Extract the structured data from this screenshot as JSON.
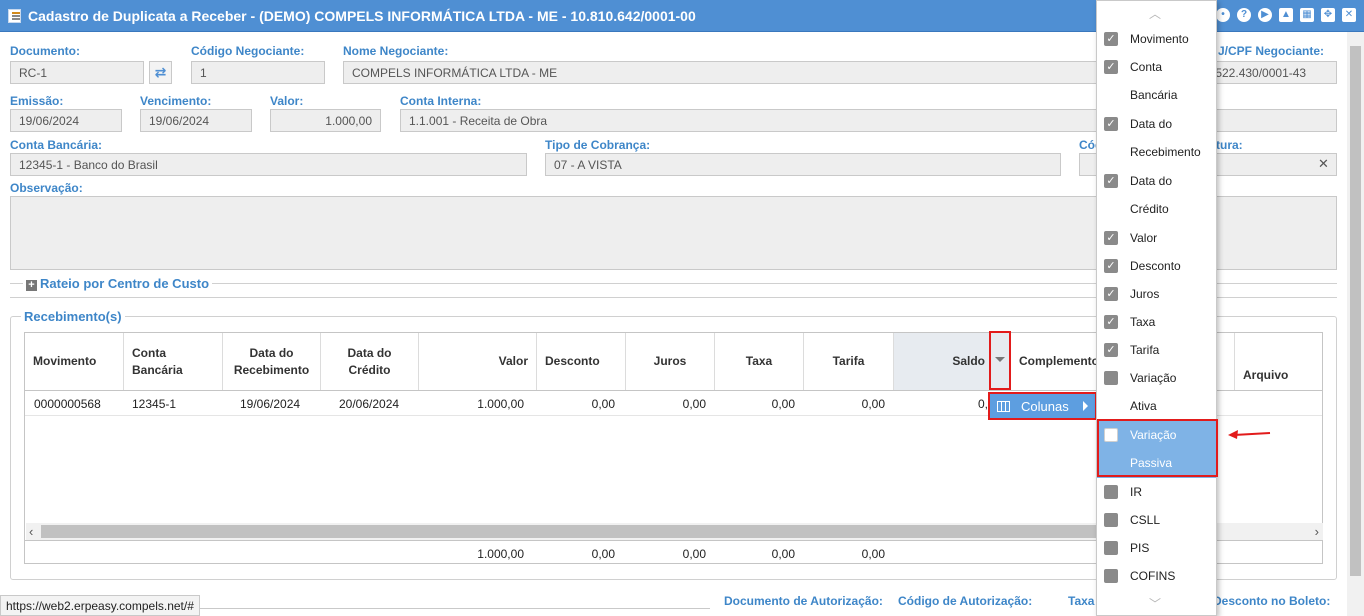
{
  "window": {
    "title": "Cadastro de Duplicata a Receber - (DEMO) COMPELS INFORMÁTICA LTDA - ME - 10.810.642/0001-00",
    "icons": [
      "settings-icon",
      "help-icon",
      "play-icon",
      "bell-icon",
      "calendar-icon",
      "expand-icon",
      "close-icon"
    ]
  },
  "form": {
    "documento_label": "Documento:",
    "documento_value": "RC-1",
    "codigo_negociante_label": "Código Negociante:",
    "codigo_negociante_value": "1",
    "nome_negociante_label": "Nome Negociante:",
    "nome_negociante_value": "COMPELS INFORMÁTICA LTDA - ME",
    "cnpj_label": "J/CPF Negociante:",
    "cnpj_value": ".522.430/0001-43",
    "emissao_label": "Emissão:",
    "emissao_value": "19/06/2024",
    "vencimento_label": "Vencimento:",
    "vencimento_value": "19/06/2024",
    "valor_label": "Valor:",
    "valor_value": "1.000,00",
    "conta_interna_label": "Conta Interna:",
    "conta_interna_value": "1.1.001 - Receita de Obra",
    "conta_bancaria_label": "Conta Bancária:",
    "conta_bancaria_value": "12345-1 - Banco do Brasil",
    "tipo_cobranca_label": "Tipo de Cobrança:",
    "tipo_cobranca_value": "07 - A VISTA",
    "codigo_truncated_label": "Cód",
    "fatura_truncated_label": "tura:",
    "observacao_label": "Observação:",
    "rateio_label": "Rateio por Centro de Custo",
    "recebimentos_label": "Recebimento(s)",
    "documento_autorizacao_label": "Documento de Autorização:",
    "codigo_autorizacao_label": "Código de Autorização:",
    "taxa_truncated_label": "Taxa",
    "desconto_boleto_label": "Desconto no Boleto:"
  },
  "grid": {
    "headers": {
      "movimento": "Movimento",
      "conta_bancaria_1": "Conta",
      "conta_bancaria_2": "Bancária",
      "data_recebimento_1": "Data do",
      "data_recebimento_2": "Recebimento",
      "data_credito_1": "Data do",
      "data_credito_2": "Crédito",
      "valor": "Valor",
      "desconto": "Desconto",
      "juros": "Juros",
      "taxa": "Taxa",
      "tarifa": "Tarifa",
      "saldo": "Saldo",
      "complemento": "Complemento",
      "arquivo": "Arquivo"
    },
    "row": {
      "movimento": "0000000568",
      "conta": "12345-1",
      "data_recebimento": "19/06/2024",
      "data_credito": "20/06/2024",
      "valor": "1.000,00",
      "desconto": "0,00",
      "juros": "0,00",
      "taxa": "0,00",
      "tarifa": "0,00",
      "saldo": "0,"
    },
    "totals": {
      "valor": "1.000,00",
      "desconto": "0,00",
      "juros": "0,00",
      "taxa": "0,00",
      "tarifa": "0,00"
    }
  },
  "column_menu": {
    "colunas_label": "Colunas",
    "items": [
      {
        "label_1": "Movimento",
        "label_2": "",
        "checked": true
      },
      {
        "label_1": "Conta",
        "label_2": "Bancária",
        "checked": true
      },
      {
        "label_1": "Data do",
        "label_2": "Recebimento",
        "checked": true
      },
      {
        "label_1": "Data do",
        "label_2": "Crédito",
        "checked": true
      },
      {
        "label_1": "Valor",
        "label_2": "",
        "checked": true
      },
      {
        "label_1": "Desconto",
        "label_2": "",
        "checked": true
      },
      {
        "label_1": "Juros",
        "label_2": "",
        "checked": true
      },
      {
        "label_1": "Taxa",
        "label_2": "",
        "checked": true
      },
      {
        "label_1": "Tarifa",
        "label_2": "",
        "checked": true
      },
      {
        "label_1": "Variação",
        "label_2": "Ativa",
        "checked": false
      },
      {
        "label_1": "Variação",
        "label_2": "Passiva",
        "checked": false
      },
      {
        "label_1": "IR",
        "label_2": "",
        "checked": false
      },
      {
        "label_1": "CSLL",
        "label_2": "",
        "checked": false
      },
      {
        "label_1": "PIS",
        "label_2": "",
        "checked": false
      },
      {
        "label_1": "COFINS",
        "label_2": "",
        "checked": false
      }
    ]
  },
  "status_bar": {
    "url": "https://web2.erpeasy.compels.net/#"
  },
  "colors": {
    "titlebar": "#4f8fd3",
    "label_blue": "#3e86c8",
    "highlight_red": "#e21b1b",
    "menu_highlight": "#7fb3e6"
  }
}
